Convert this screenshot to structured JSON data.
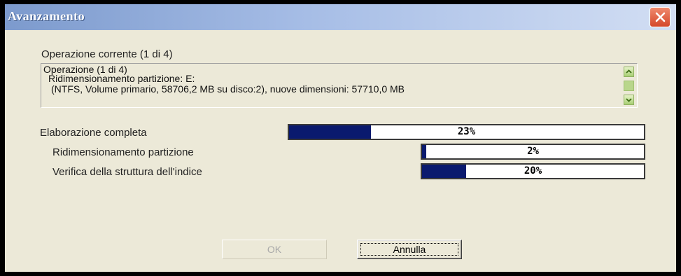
{
  "window": {
    "title": "Avanzamento",
    "close_icon": "close-icon"
  },
  "current_operation": {
    "label": "Operazione corrente (1 di 4)",
    "log_lines": [
      "Operazione (1 di 4)",
      "Ridimensionamento partizione: E:",
      "(NTFS, Volume primario, 58706,2 MB su disco:2), nuove dimensioni: 57710,0 MB"
    ]
  },
  "progress": [
    {
      "label": "Elaborazione completa",
      "value_text": "23%",
      "fraction": 0.23
    },
    {
      "label": "Ridimensionamento partizione",
      "value_text": "2%",
      "fraction": 0.02
    },
    {
      "label": "Verifica della struttura dell'indice",
      "value_text": "20%",
      "fraction": 0.2
    }
  ],
  "buttons": {
    "ok": "OK",
    "cancel": "Annulla"
  },
  "colors": {
    "progress_fill": "#0a1a6e",
    "dialog_background": "#ece9d8"
  }
}
